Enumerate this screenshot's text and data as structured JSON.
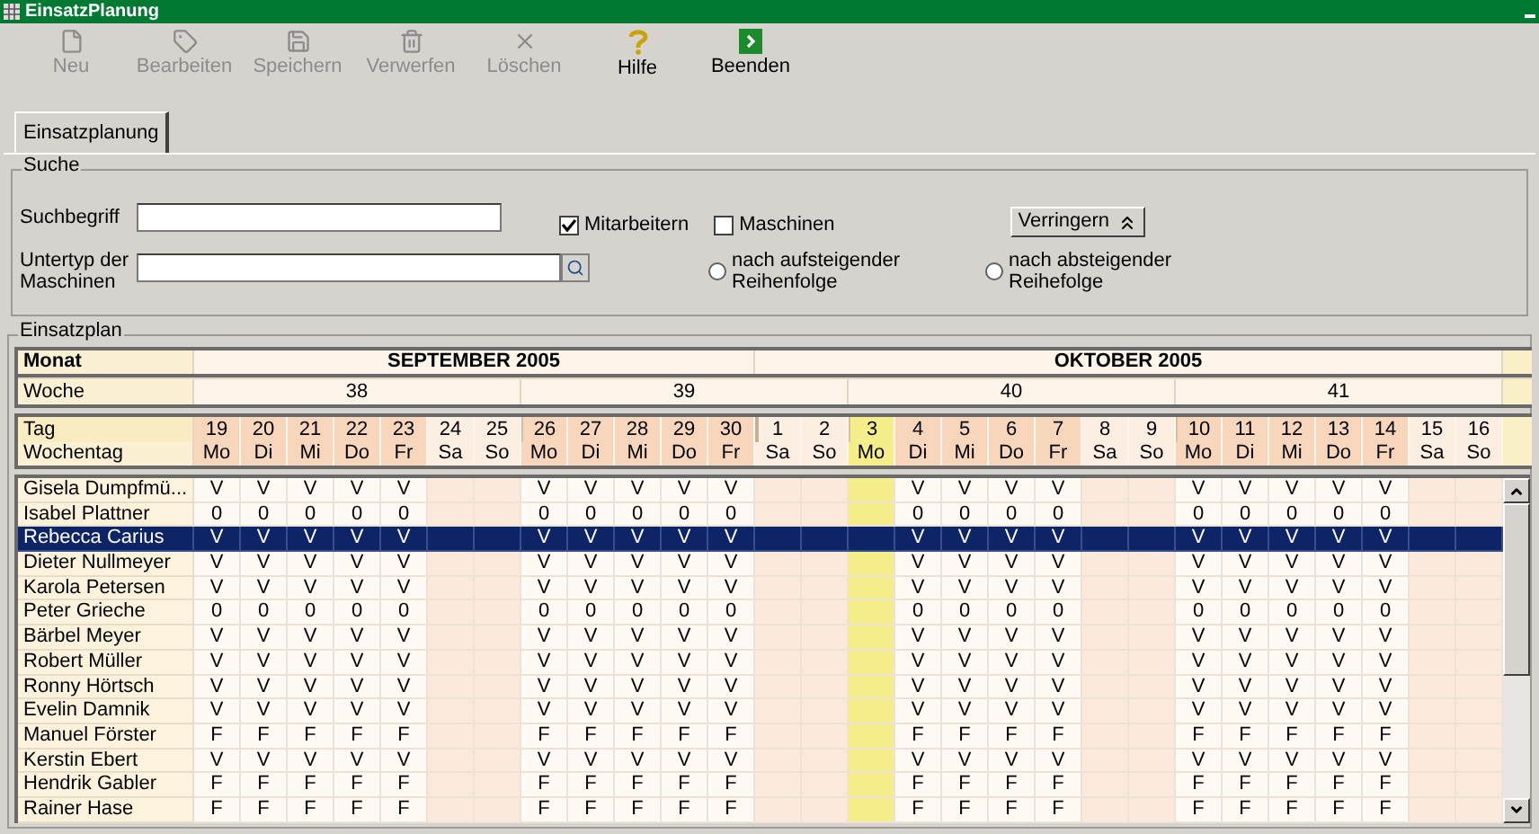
{
  "window": {
    "title": "EinsatzPlanung"
  },
  "toolbar": [
    {
      "label": "Neu",
      "kind": "new",
      "disabled": true
    },
    {
      "label": "Bearbeiten",
      "kind": "edit",
      "disabled": true
    },
    {
      "label": "Speichern",
      "kind": "save",
      "disabled": true
    },
    {
      "label": "Verwerfen",
      "kind": "discard",
      "disabled": true
    },
    {
      "label": "Löschen",
      "kind": "delete",
      "disabled": true
    },
    {
      "label": "Hilfe",
      "kind": "help",
      "disabled": false
    },
    {
      "label": "Beenden",
      "kind": "exit",
      "disabled": false
    }
  ],
  "tabs": [
    {
      "label": "Einsatzplanung",
      "selected": true
    }
  ],
  "search": {
    "title": "Suche",
    "term_label": "Suchbegriff",
    "subtype_label": "Untertyp der Maschinen",
    "options": [
      {
        "label": "Mitarbeitern",
        "checked": true
      },
      {
        "label": "Maschinen",
        "checked": false
      }
    ],
    "collapse_button": "Verringern",
    "sort": [
      {
        "label": "nach aufsteigender Reihenfolge",
        "selected": false
      },
      {
        "label": "nach absteigender Reihefolge",
        "selected": false
      }
    ]
  },
  "plan": {
    "title": "Einsatzplan",
    "labels": {
      "month": "Monat",
      "week": "Woche",
      "day": "Tag",
      "weekday": "Wochentag"
    },
    "months": [
      "SEPTEMBER 2005",
      "OKTOBER 2005"
    ],
    "weeks": [
      "38",
      "39",
      "40",
      "41"
    ],
    "days": [
      {
        "day": "19",
        "weekday": "Mo",
        "kind": "workday",
        "new_month": false,
        "new_week": false
      },
      {
        "day": "20",
        "weekday": "Di",
        "kind": "workday",
        "new_month": false,
        "new_week": false
      },
      {
        "day": "21",
        "weekday": "Mi",
        "kind": "workday",
        "new_month": false,
        "new_week": false
      },
      {
        "day": "22",
        "weekday": "Do",
        "kind": "workday",
        "new_month": false,
        "new_week": false
      },
      {
        "day": "23",
        "weekday": "Fr",
        "kind": "workday",
        "new_month": false,
        "new_week": false
      },
      {
        "day": "24",
        "weekday": "Sa",
        "kind": "weekend",
        "new_month": false,
        "new_week": false
      },
      {
        "day": "25",
        "weekday": "So",
        "kind": "weekend",
        "new_month": false,
        "new_week": false
      },
      {
        "day": "26",
        "weekday": "Mo",
        "kind": "workday",
        "new_month": false,
        "new_week": true
      },
      {
        "day": "27",
        "weekday": "Di",
        "kind": "workday",
        "new_month": false,
        "new_week": false
      },
      {
        "day": "28",
        "weekday": "Mi",
        "kind": "workday",
        "new_month": false,
        "new_week": false
      },
      {
        "day": "29",
        "weekday": "Do",
        "kind": "workday",
        "new_month": false,
        "new_week": false
      },
      {
        "day": "30",
        "weekday": "Fr",
        "kind": "workday",
        "new_month": false,
        "new_week": false
      },
      {
        "day": "1",
        "weekday": "Sa",
        "kind": "weekend",
        "new_month": true,
        "new_week": false
      },
      {
        "day": "2",
        "weekday": "So",
        "kind": "weekend",
        "new_month": false,
        "new_week": false
      },
      {
        "day": "3",
        "weekday": "Mo",
        "kind": "today",
        "new_month": false,
        "new_week": true
      },
      {
        "day": "4",
        "weekday": "Di",
        "kind": "workday",
        "new_month": false,
        "new_week": false
      },
      {
        "day": "5",
        "weekday": "Mi",
        "kind": "workday",
        "new_month": false,
        "new_week": false
      },
      {
        "day": "6",
        "weekday": "Do",
        "kind": "workday",
        "new_month": false,
        "new_week": false
      },
      {
        "day": "7",
        "weekday": "Fr",
        "kind": "workday",
        "new_month": false,
        "new_week": false
      },
      {
        "day": "8",
        "weekday": "Sa",
        "kind": "weekend",
        "new_month": false,
        "new_week": false
      },
      {
        "day": "9",
        "weekday": "So",
        "kind": "weekend",
        "new_month": false,
        "new_week": false
      },
      {
        "day": "10",
        "weekday": "Mo",
        "kind": "workday",
        "new_month": false,
        "new_week": true
      },
      {
        "day": "11",
        "weekday": "Di",
        "kind": "workday",
        "new_month": false,
        "new_week": false
      },
      {
        "day": "12",
        "weekday": "Mi",
        "kind": "workday",
        "new_month": false,
        "new_week": false
      },
      {
        "day": "13",
        "weekday": "Do",
        "kind": "workday",
        "new_month": false,
        "new_week": false
      },
      {
        "day": "14",
        "weekday": "Fr",
        "kind": "workday",
        "new_month": false,
        "new_week": false
      },
      {
        "day": "15",
        "weekday": "Sa",
        "kind": "weekend",
        "new_month": false,
        "new_week": false
      },
      {
        "day": "16",
        "weekday": "So",
        "kind": "weekend",
        "new_month": false,
        "new_week": false
      }
    ],
    "rows": [
      {
        "name": "Gisela Dumpfmü...",
        "selected": false,
        "cells": [
          "V",
          "V",
          "V",
          "V",
          "V",
          null,
          null,
          "V",
          "V",
          "V",
          "V",
          "V",
          null,
          null,
          null,
          "V",
          "V",
          "V",
          "V",
          null,
          null,
          "V",
          "V",
          "V",
          "V",
          "V",
          null,
          null
        ]
      },
      {
        "name": "Isabel Plattner",
        "selected": false,
        "cells": [
          "0",
          "0",
          "0",
          "0",
          "0",
          null,
          null,
          "0",
          "0",
          "0",
          "0",
          "0",
          null,
          null,
          null,
          "0",
          "0",
          "0",
          "0",
          null,
          null,
          "0",
          "0",
          "0",
          "0",
          "0",
          null,
          null
        ]
      },
      {
        "name": "Rebecca Carius",
        "selected": true,
        "cells": [
          "V",
          "V",
          "V",
          "V",
          "V",
          null,
          null,
          "V",
          "V",
          "V",
          "V",
          "V",
          null,
          null,
          null,
          "V",
          "V",
          "V",
          "V",
          null,
          null,
          "V",
          "V",
          "V",
          "V",
          "V",
          null,
          null
        ]
      },
      {
        "name": "Dieter Nullmeyer",
        "selected": false,
        "cells": [
          "V",
          "V",
          "V",
          "V",
          "V",
          null,
          null,
          "V",
          "V",
          "V",
          "V",
          "V",
          null,
          null,
          null,
          "V",
          "V",
          "V",
          "V",
          null,
          null,
          "V",
          "V",
          "V",
          "V",
          "V",
          null,
          null
        ]
      },
      {
        "name": "Karola Petersen",
        "selected": false,
        "cells": [
          "V",
          "V",
          "V",
          "V",
          "V",
          null,
          null,
          "V",
          "V",
          "V",
          "V",
          "V",
          null,
          null,
          null,
          "V",
          "V",
          "V",
          "V",
          null,
          null,
          "V",
          "V",
          "V",
          "V",
          "V",
          null,
          null
        ]
      },
      {
        "name": "Peter Grieche",
        "selected": false,
        "cells": [
          "0",
          "0",
          "0",
          "0",
          "0",
          null,
          null,
          "0",
          "0",
          "0",
          "0",
          "0",
          null,
          null,
          null,
          "0",
          "0",
          "0",
          "0",
          null,
          null,
          "0",
          "0",
          "0",
          "0",
          "0",
          null,
          null
        ]
      },
      {
        "name": "Bärbel Meyer",
        "selected": false,
        "cells": [
          "V",
          "V",
          "V",
          "V",
          "V",
          null,
          null,
          "V",
          "V",
          "V",
          "V",
          "V",
          null,
          null,
          null,
          "V",
          "V",
          "V",
          "V",
          null,
          null,
          "V",
          "V",
          "V",
          "V",
          "V",
          null,
          null
        ]
      },
      {
        "name": "Robert Müller",
        "selected": false,
        "cells": [
          "V",
          "V",
          "V",
          "V",
          "V",
          null,
          null,
          "V",
          "V",
          "V",
          "V",
          "V",
          null,
          null,
          null,
          "V",
          "V",
          "V",
          "V",
          null,
          null,
          "V",
          "V",
          "V",
          "V",
          "V",
          null,
          null
        ]
      },
      {
        "name": "Ronny Hörtsch",
        "selected": false,
        "cells": [
          "V",
          "V",
          "V",
          "V",
          "V",
          null,
          null,
          "V",
          "V",
          "V",
          "V",
          "V",
          null,
          null,
          null,
          "V",
          "V",
          "V",
          "V",
          null,
          null,
          "V",
          "V",
          "V",
          "V",
          "V",
          null,
          null
        ]
      },
      {
        "name": "Evelin Damnik",
        "selected": false,
        "cells": [
          "V",
          "V",
          "V",
          "V",
          "V",
          null,
          null,
          "V",
          "V",
          "V",
          "V",
          "V",
          null,
          null,
          null,
          "V",
          "V",
          "V",
          "V",
          null,
          null,
          "V",
          "V",
          "V",
          "V",
          "V",
          null,
          null
        ]
      },
      {
        "name": "Manuel Förster",
        "selected": false,
        "cells": [
          "F",
          "F",
          "F",
          "F",
          "F",
          null,
          null,
          "F",
          "F",
          "F",
          "F",
          "F",
          null,
          null,
          null,
          "F",
          "F",
          "F",
          "F",
          null,
          null,
          "F",
          "F",
          "F",
          "F",
          "F",
          null,
          null
        ]
      },
      {
        "name": "Kerstin Ebert",
        "selected": false,
        "cells": [
          "V",
          "V",
          "V",
          "V",
          "V",
          null,
          null,
          "V",
          "V",
          "V",
          "V",
          "V",
          null,
          null,
          null,
          "V",
          "V",
          "V",
          "V",
          null,
          null,
          "V",
          "V",
          "V",
          "V",
          "V",
          null,
          null
        ]
      },
      {
        "name": "Hendrik Gabler",
        "selected": false,
        "cells": [
          "F",
          "F",
          "F",
          "F",
          "F",
          null,
          null,
          "F",
          "F",
          "F",
          "F",
          "F",
          null,
          null,
          null,
          "F",
          "F",
          "F",
          "F",
          null,
          null,
          "F",
          "F",
          "F",
          "F",
          "F",
          null,
          null
        ]
      },
      {
        "name": "Rainer Hase",
        "selected": false,
        "cells": [
          "F",
          "F",
          "F",
          "F",
          "F",
          null,
          null,
          "F",
          "F",
          "F",
          "F",
          "F",
          null,
          null,
          null,
          "F",
          "F",
          "F",
          "F",
          null,
          null,
          "F",
          "F",
          "F",
          "F",
          "F",
          null,
          null
        ]
      }
    ]
  }
}
